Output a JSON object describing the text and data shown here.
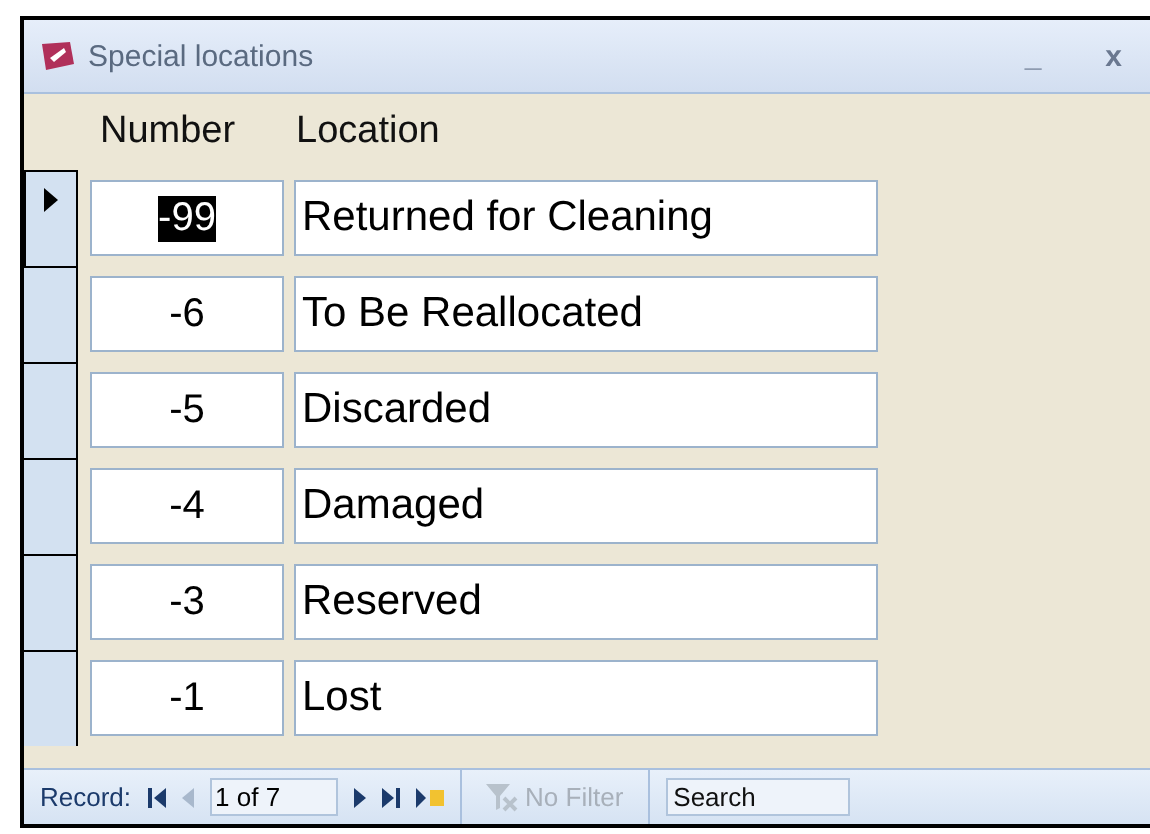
{
  "window": {
    "title": "Special locations",
    "minimize": "_",
    "close": "x"
  },
  "columns": [
    "Number",
    "Location"
  ],
  "rows": [
    {
      "number": "-99",
      "location": "Returned for Cleaning",
      "selected": true
    },
    {
      "number": "-6",
      "location": "To Be Reallocated",
      "selected": false
    },
    {
      "number": "-5",
      "location": "Discarded",
      "selected": false
    },
    {
      "number": "-4",
      "location": "Damaged",
      "selected": false
    },
    {
      "number": "-3",
      "location": "Reserved",
      "selected": false
    },
    {
      "number": "-1",
      "location": "Lost",
      "selected": false
    }
  ],
  "navigation": {
    "label": "Record:",
    "position": "1 of 7",
    "filter": "No Filter",
    "filter_disabled": true,
    "search": {
      "placeholder": "Search"
    }
  }
}
